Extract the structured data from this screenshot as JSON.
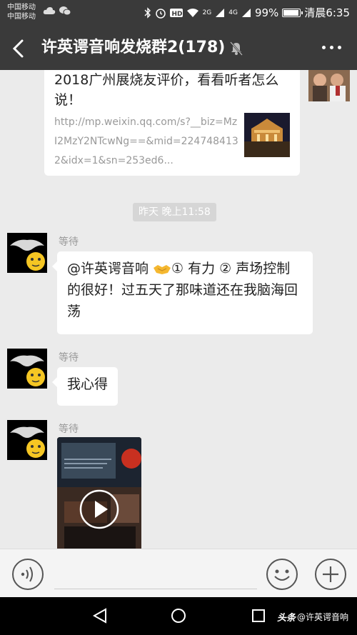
{
  "status_bar": {
    "carrier_1": "中国移动",
    "carrier_2": "中国移动",
    "net_1": "2G",
    "net_2": "4G",
    "battery": "99%",
    "battery_level": 0.99,
    "time": "清晨6:35"
  },
  "header": {
    "title": "许英谔音响发烧群2(178)"
  },
  "chat": {
    "link_card": {
      "title": "2018广州展烧友评价，看看听者怎么说！",
      "url": "http://mp.weixin.qq.com/s?__biz=MzI2MzY2NTcwNg==&mid=2247484132&idx=1&sn=253ed6..."
    },
    "timestamp": "昨天 晚上11:58",
    "messages": [
      {
        "sender": "等待",
        "text_before": "@许英谔音响 ",
        "text_after": "① 有力 ② 声场控制的很好！过五天了那味道还在我脑海回荡"
      },
      {
        "sender": "等待",
        "text": "我心得"
      },
      {
        "sender": "等待",
        "type": "video"
      }
    ]
  },
  "watermark": {
    "brand": "头条",
    "handle": "@许英谔音响"
  }
}
